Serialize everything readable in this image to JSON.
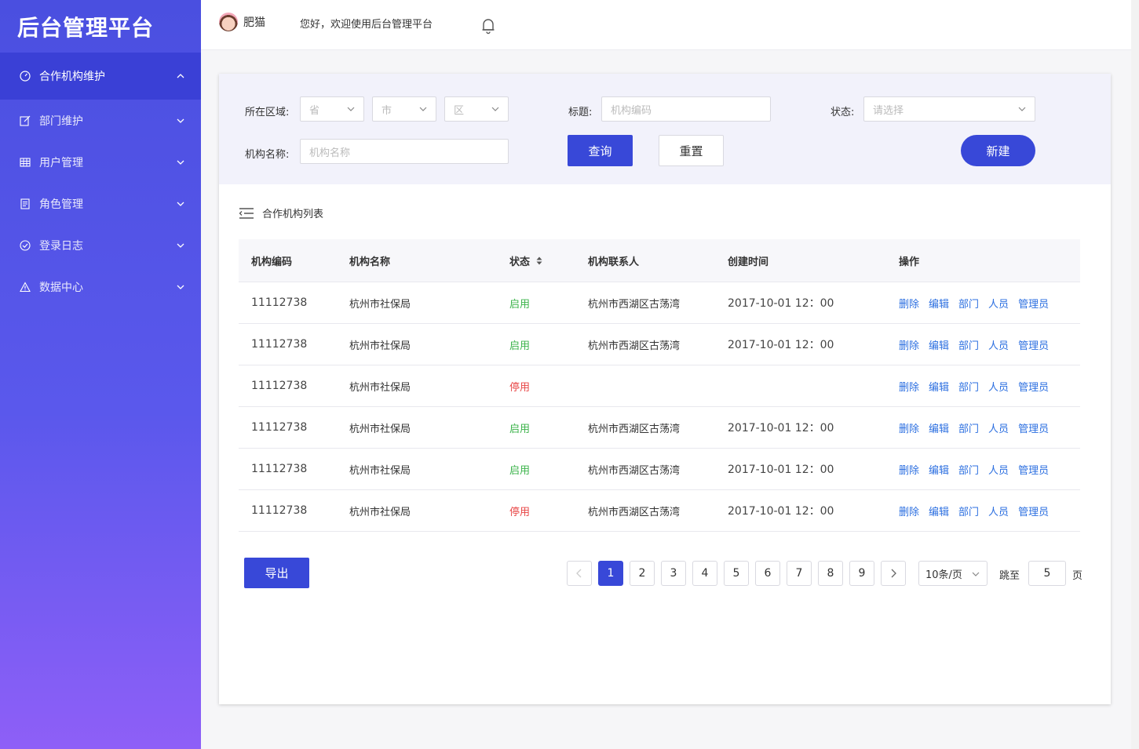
{
  "sidebar": {
    "logo": "后台管理平台",
    "items": [
      {
        "label": "合作机构维护",
        "icon": "gauge-icon",
        "active": true
      },
      {
        "label": "部门维护",
        "icon": "edit-icon"
      },
      {
        "label": "用户管理",
        "icon": "table-icon"
      },
      {
        "label": "角色管理",
        "icon": "document-icon"
      },
      {
        "label": "登录日志",
        "icon": "check-circle-icon"
      },
      {
        "label": "数据中心",
        "icon": "warning-icon"
      }
    ]
  },
  "header": {
    "username": "肥猫",
    "welcome": "您好，欢迎使用后台管理平台"
  },
  "filter": {
    "region_label": "所在区域:",
    "province_placeholder": "省",
    "city_placeholder": "市",
    "district_placeholder": "区",
    "title_label": "标题:",
    "title_placeholder": "机构编码",
    "status_label": "状态:",
    "status_placeholder": "请选择",
    "org_name_label": "机构名称:",
    "org_name_placeholder": "机构名称",
    "query_button": "查询",
    "reset_button": "重置",
    "new_button": "新建"
  },
  "list": {
    "title": "合作机构列表",
    "columns": [
      "机构编码",
      "机构名称",
      "状态",
      "机构联系人",
      "创建时间",
      "操作"
    ],
    "actions": [
      "删除",
      "编辑",
      "部门",
      "人员",
      "管理员"
    ],
    "rows": [
      {
        "code": "11112738",
        "name": "杭州市社保局",
        "status": "启用",
        "status_type": "on",
        "contact": "杭州市西湖区古荡湾",
        "created": "2017-10-01 12：00"
      },
      {
        "code": "11112738",
        "name": "杭州市社保局",
        "status": "启用",
        "status_type": "on",
        "contact": "杭州市西湖区古荡湾",
        "created": "2017-10-01 12：00"
      },
      {
        "code": "11112738",
        "name": "杭州市社保局",
        "status": "停用",
        "status_type": "off",
        "contact": "",
        "created": ""
      },
      {
        "code": "11112738",
        "name": "杭州市社保局",
        "status": "启用",
        "status_type": "on",
        "contact": "杭州市西湖区古荡湾",
        "created": "2017-10-01 12：00"
      },
      {
        "code": "11112738",
        "name": "杭州市社保局",
        "status": "启用",
        "status_type": "on",
        "contact": "杭州市西湖区古荡湾",
        "created": "2017-10-01 12：00"
      },
      {
        "code": "11112738",
        "name": "杭州市社保局",
        "status": "停用",
        "status_type": "off",
        "contact": "杭州市西湖区古荡湾",
        "created": "2017-10-01 12：00"
      }
    ]
  },
  "footer": {
    "export_button": "导出",
    "pages": [
      "1",
      "2",
      "3",
      "4",
      "5",
      "6",
      "7",
      "8",
      "9"
    ],
    "current_page": "1",
    "page_size": "10条/页",
    "jump_label": "跳至",
    "jump_value": "5",
    "page_suffix": "页"
  },
  "colors": {
    "primary": "#3848d8",
    "enabled": "#3bb34a",
    "disabled": "#e84545",
    "link": "#2c6fe0"
  }
}
